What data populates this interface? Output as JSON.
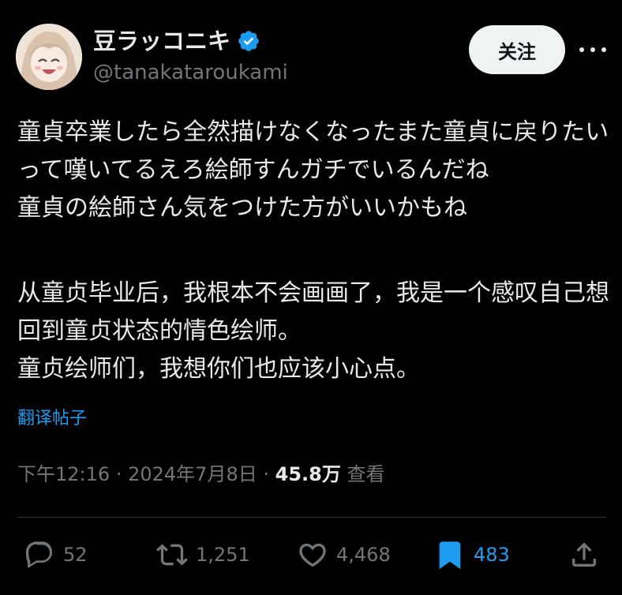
{
  "user": {
    "display_name": "豆ラッコニキ",
    "handle": "@tanakataroukami",
    "verified": true
  },
  "follow_button": {
    "label": "关注"
  },
  "tweet": {
    "text": "童貞卒業したら全然描けなくなったまた童貞に戻りたいって嘆いてるえろ絵師すんガチでいるんだね\n童貞の絵師さん気をつけた方がいいかもね",
    "translation": "从童贞毕业后，我根本不会画画了，我是一个感叹自己想回到童贞状态的情色绘师。\n童贞绘师们，我想你们也应该小心点。",
    "translate_link": "翻译帖子"
  },
  "meta": {
    "time": "下午12:16",
    "separator": "·",
    "date": "2024年7月8日",
    "views_count": "45.8万",
    "views_label": "查看"
  },
  "actions": {
    "replies": "52",
    "reposts": "1,251",
    "likes": "4,468",
    "bookmarks": "483"
  },
  "colors": {
    "background": "#000000",
    "text": "#e7e9ea",
    "secondary": "#71767b",
    "accent": "#1d9bf0",
    "divider": "#2f3336"
  }
}
